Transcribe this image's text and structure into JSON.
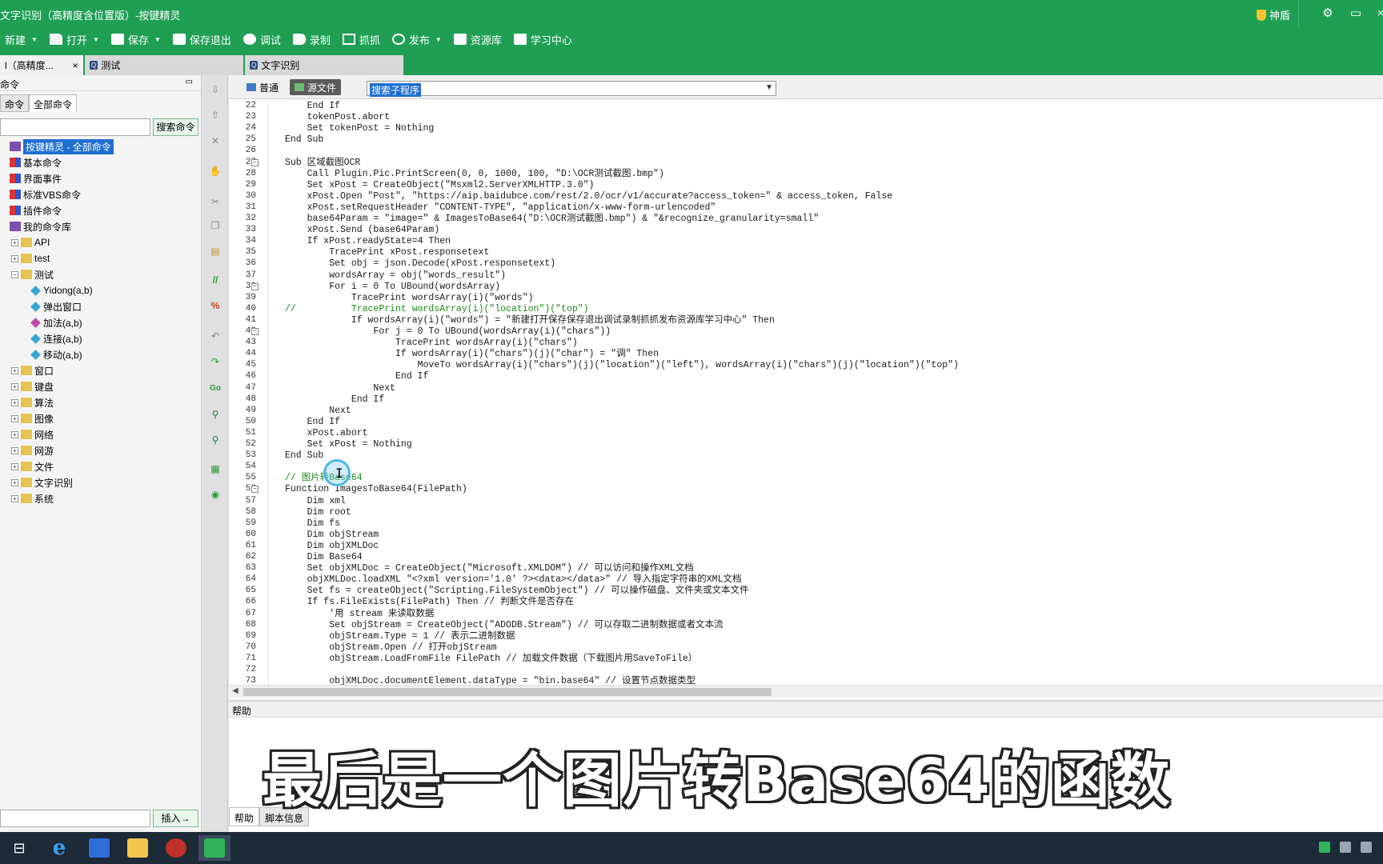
{
  "window": {
    "title": "文字识别（高精度含位置版）-按键精灵",
    "shield_label": "神盾",
    "controls": [
      "gear-icon",
      "minimize-icon",
      "close-icon"
    ]
  },
  "toolbar": {
    "new": "新建",
    "open": "打开",
    "save": "保存",
    "save_exit": "保存退出",
    "debug": "调试",
    "record": "录制",
    "capture": "抓抓",
    "publish": "发布",
    "resources": "资源库",
    "learn": "学习中心"
  },
  "doc_tabs": [
    {
      "label": "l（高精度..."
    },
    {
      "label": "测试"
    },
    {
      "label": "文字识别"
    }
  ],
  "left_panel": {
    "header": "命令",
    "tab_basic": "命令",
    "tab_all": "全部命令",
    "search_button": "搜索命令",
    "insert_button": "插入→",
    "tree": [
      {
        "label": "按键精灵 - 全部命令",
        "level": 0,
        "icon": "cube",
        "selected": true
      },
      {
        "label": "基本命令",
        "level": 0,
        "icon": "grid"
      },
      {
        "label": "界面事件",
        "level": 0,
        "icon": "grid"
      },
      {
        "label": "标准VBS命令",
        "level": 0,
        "icon": "grid"
      },
      {
        "label": "插件命令",
        "level": 0,
        "icon": "grid"
      },
      {
        "label": "我的命令库",
        "level": 0,
        "icon": "cube"
      },
      {
        "label": "API",
        "level": 1,
        "icon": "folder"
      },
      {
        "label": "test",
        "level": 1,
        "icon": "folder"
      },
      {
        "label": "测试",
        "level": 1,
        "icon": "folder"
      },
      {
        "label": "Yidong(a,b)",
        "level": 2,
        "icon": "diamond"
      },
      {
        "label": "弹出窗口",
        "level": 2,
        "icon": "diamond"
      },
      {
        "label": "加法(a,b)",
        "level": 2,
        "icon": "diamond-pink"
      },
      {
        "label": "连接(a,b)",
        "level": 2,
        "icon": "diamond"
      },
      {
        "label": "移动(a,b)",
        "level": 2,
        "icon": "diamond"
      },
      {
        "label": "窗口",
        "level": 1,
        "icon": "folder"
      },
      {
        "label": "键盘",
        "level": 1,
        "icon": "folder"
      },
      {
        "label": "算法",
        "level": 1,
        "icon": "folder"
      },
      {
        "label": "图像",
        "level": 1,
        "icon": "folder"
      },
      {
        "label": "网络",
        "level": 1,
        "icon": "folder"
      },
      {
        "label": "网游",
        "level": 1,
        "icon": "folder"
      },
      {
        "label": "文件",
        "level": 1,
        "icon": "folder"
      },
      {
        "label": "文字识别",
        "level": 1,
        "icon": "folder"
      },
      {
        "label": "系统",
        "level": 1,
        "icon": "folder"
      }
    ]
  },
  "editor": {
    "mode_normal": "普通",
    "mode_source": "源文件",
    "sub_selector": "搜索子程序",
    "lines": [
      {
        "n": "22",
        "text": "    End If"
      },
      {
        "n": "23",
        "text": "    tokenPost.abort"
      },
      {
        "n": "24",
        "text": "    Set tokenPost = Nothing"
      },
      {
        "n": "25",
        "text": "End Sub"
      },
      {
        "n": "26",
        "text": ""
      },
      {
        "n": "27",
        "text": "Sub 区域截图OCR"
      },
      {
        "n": "28",
        "text": "    Call Plugin.Pic.PrintScreen(0, 0, 1000, 100, \"D:\\OCR测试截图.bmp\")"
      },
      {
        "n": "29",
        "text": "    Set xPost = CreateObject(\"Msxml2.ServerXMLHTTP.3.0\")"
      },
      {
        "n": "30",
        "text": "    xPost.Open \"Post\", \"https://aip.baidubce.com/rest/2.0/ocr/v1/accurate?access_token=\" & access_token, False"
      },
      {
        "n": "31",
        "text": "    xPost.setRequestHeader \"CONTENT-TYPE\", \"application/x-www-form-urlencoded\""
      },
      {
        "n": "32",
        "text": "    base64Param = \"image=\" & ImagesToBase64(\"D:\\OCR测试截图.bmp\") & \"&recognize_granularity=small\""
      },
      {
        "n": "33",
        "text": "    xPost.Send (base64Param)"
      },
      {
        "n": "34",
        "text": "    If xPost.readyState=4 Then"
      },
      {
        "n": "35",
        "text": "        TracePrint xPost.responsetext"
      },
      {
        "n": "36",
        "text": "        Set obj = json.Decode(xPost.responsetext)"
      },
      {
        "n": "37",
        "text": "        wordsArray = obj(\"words_result\")"
      },
      {
        "n": "38",
        "text": "        For i = 0 To UBound(wordsArray)"
      },
      {
        "n": "39",
        "text": "            TracePrint wordsArray(i)(\"words\")"
      },
      {
        "n": "40",
        "text": "//          TracePrint wordsArray(i)(\"location\")(\"top\")"
      },
      {
        "n": "41",
        "text": "            If wordsArray(i)(\"words\") = \"新建打开保存保存退出调试录制抓抓发布资源库学习中心\" Then"
      },
      {
        "n": "42",
        "text": "                For j = 0 To UBound(wordsArray(i)(\"chars\"))"
      },
      {
        "n": "43",
        "text": "                    TracePrint wordsArray(i)(\"chars\")"
      },
      {
        "n": "44",
        "text": "                    If wordsArray(i)(\"chars\")(j)(\"char\") = \"调\" Then"
      },
      {
        "n": "45",
        "text": "                        MoveTo wordsArray(i)(\"chars\")(j)(\"location\")(\"left\"), wordsArray(i)(\"chars\")(j)(\"location\")(\"top\")"
      },
      {
        "n": "46",
        "text": "                    End If"
      },
      {
        "n": "47",
        "text": "                Next"
      },
      {
        "n": "48",
        "text": "            End If"
      },
      {
        "n": "49",
        "text": "        Next"
      },
      {
        "n": "50",
        "text": "    End If"
      },
      {
        "n": "51",
        "text": "    xPost.abort"
      },
      {
        "n": "52",
        "text": "    Set xPost = Nothing"
      },
      {
        "n": "53",
        "text": "End Sub"
      },
      {
        "n": "54",
        "text": ""
      },
      {
        "n": "55",
        "text": "// 图片转Base64"
      },
      {
        "n": "56",
        "text": "Function ImagesToBase64(FilePath)"
      },
      {
        "n": "57",
        "text": "    Dim xml"
      },
      {
        "n": "58",
        "text": "    Dim root"
      },
      {
        "n": "59",
        "text": "    Dim fs"
      },
      {
        "n": "60",
        "text": "    Dim objStream"
      },
      {
        "n": "61",
        "text": "    Dim objXMLDoc"
      },
      {
        "n": "62",
        "text": "    Dim Base64"
      },
      {
        "n": "63",
        "text": "    Set objXMLDoc = CreateObject(\"Microsoft.XMLDOM\") // 可以访问和操作XML文档"
      },
      {
        "n": "64",
        "text": "    objXMLDoc.loadXML \"<?xml version='1.0' ?><data></data>\" // 导入指定字符串的XML文档"
      },
      {
        "n": "65",
        "text": "    Set fs = createObject(\"Scripting.FileSystemObject\") // 可以操作磁盘、文件夹或文本文件"
      },
      {
        "n": "66",
        "text": "    If fs.FileExists(FilePath) Then // 判断文件是否存在"
      },
      {
        "n": "67",
        "text": "        '用 stream 来读取数据"
      },
      {
        "n": "68",
        "text": "        Set objStream = CreateObject(\"ADODB.Stream\") // 可以存取二进制数据或者文本流"
      },
      {
        "n": "69",
        "text": "        objStream.Type = 1 // 表示二进制数据"
      },
      {
        "n": "70",
        "text": "        objStream.Open // 打开objStream"
      },
      {
        "n": "71",
        "text": "        objStream.LoadFromFile FilePath // 加载文件数据（下载图片用SaveToFile）"
      },
      {
        "n": "72",
        "text": ""
      },
      {
        "n": "73",
        "text": "        objXMLDoc.documentElement.dataType = \"bin.base64\" // 设置节点数据类型"
      }
    ]
  },
  "help": {
    "title": "帮助",
    "tab_help": "帮助",
    "tab_script_info": "脚本信息"
  },
  "subtitle": "最后是一个图片转Base64的函数"
}
